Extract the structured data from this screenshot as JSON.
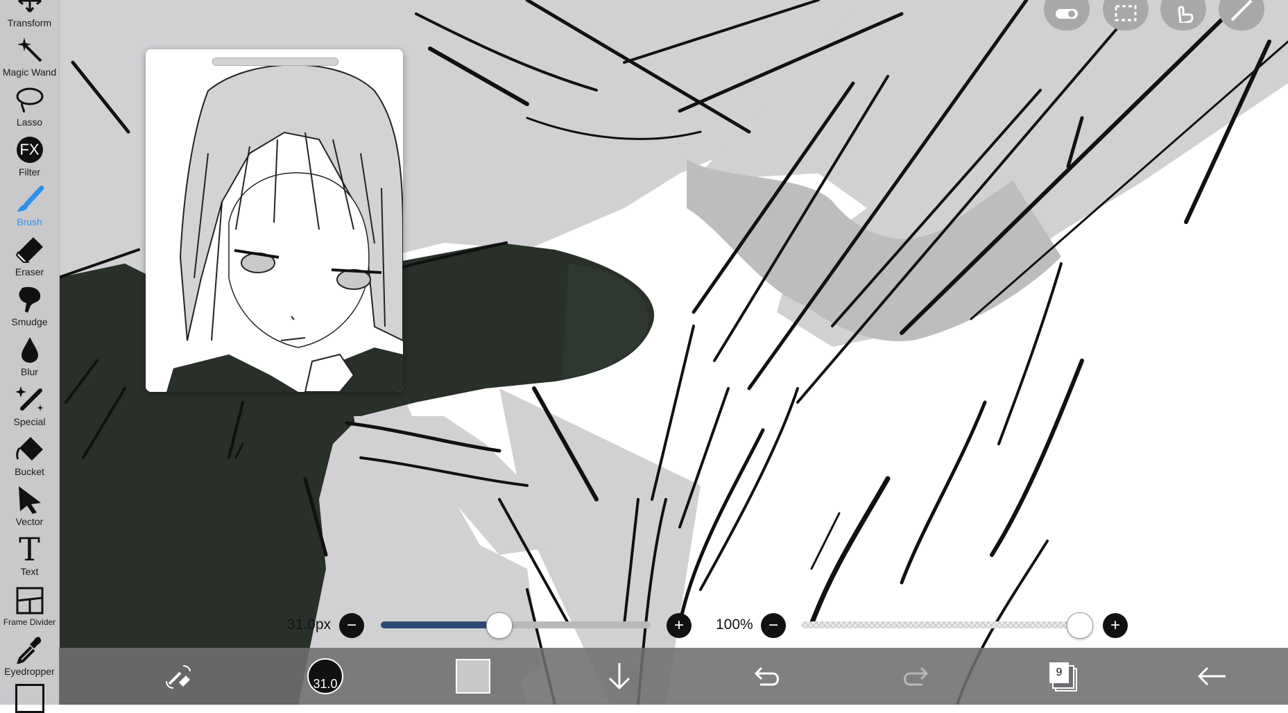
{
  "toolbar": {
    "tools": [
      {
        "id": "transform",
        "label": "Transform",
        "icon": "move-arrows-icon"
      },
      {
        "id": "magic-wand",
        "label": "Magic Wand",
        "icon": "magic-wand-icon"
      },
      {
        "id": "lasso",
        "label": "Lasso",
        "icon": "lasso-icon"
      },
      {
        "id": "filter",
        "label": "Filter",
        "icon": "fx-icon",
        "icon_text": "FX"
      },
      {
        "id": "brush",
        "label": "Brush",
        "icon": "brush-icon",
        "active": true
      },
      {
        "id": "eraser",
        "label": "Eraser",
        "icon": "eraser-icon"
      },
      {
        "id": "smudge",
        "label": "Smudge",
        "icon": "smudge-icon"
      },
      {
        "id": "blur",
        "label": "Blur",
        "icon": "droplet-icon"
      },
      {
        "id": "special",
        "label": "Special",
        "icon": "sparkle-pen-icon"
      },
      {
        "id": "bucket",
        "label": "Bucket",
        "icon": "bucket-icon"
      },
      {
        "id": "vector",
        "label": "Vector",
        "icon": "cursor-arrow-icon"
      },
      {
        "id": "text",
        "label": "Text",
        "icon": "text-icon",
        "icon_text": "T"
      },
      {
        "id": "frame-divider",
        "label": "Frame Divider",
        "icon": "frame-divider-icon"
      },
      {
        "id": "eyedropper",
        "label": "Eyedropper",
        "icon": "eyedropper-icon"
      }
    ],
    "active_color": "#2f8fe8"
  },
  "top_buttons": [
    {
      "id": "toggle",
      "icon": "toggle-icon"
    },
    {
      "id": "selection",
      "icon": "selection-rect-icon"
    },
    {
      "id": "hand",
      "icon": "hand-pointer-icon"
    },
    {
      "id": "ruler",
      "icon": "ruler-pen-icon"
    }
  ],
  "brush_size": {
    "value_text": "31.0px",
    "slider_fraction": 0.44,
    "minus": "−",
    "plus": "+"
  },
  "opacity": {
    "value_text": "100%",
    "slider_fraction": 1.0,
    "minus": "−",
    "plus": "+"
  },
  "bottom_bar": {
    "brush_size_badge": "31.0",
    "layer_count": "9",
    "color_swatch": "#c8c8cb",
    "icons": [
      "pen-eraser-swap-icon",
      "brush-size-circle-icon",
      "color-swatch",
      "download-arrow-icon",
      "undo-icon",
      "redo-icon",
      "layers-icon",
      "back-arrow-icon"
    ]
  },
  "colors": {
    "canvas_gray": "#d1d1d4",
    "cloak_dark": "#283029",
    "toolbar_bg": "#c9c9cc",
    "bottom_bar_bg": "#6e6e72"
  }
}
